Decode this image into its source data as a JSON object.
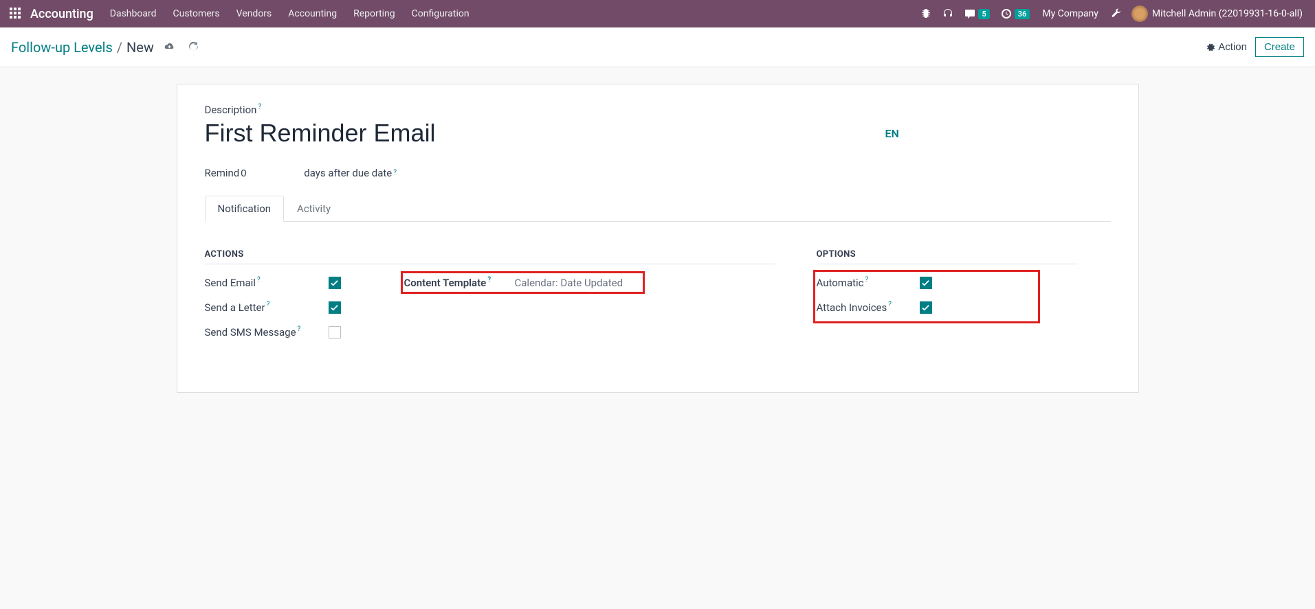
{
  "navbar": {
    "brand": "Accounting",
    "items": [
      "Dashboard",
      "Customers",
      "Vendors",
      "Accounting",
      "Reporting",
      "Configuration"
    ],
    "messages_count": "5",
    "activities_count": "36",
    "company": "My Company",
    "user": "Mitchell Admin (22019931-16-0-all)"
  },
  "breadcrumb": {
    "parent": "Follow-up Levels",
    "current": "New"
  },
  "controls": {
    "action_label": "Action",
    "create_label": "Create"
  },
  "form": {
    "description_label": "Description",
    "title": "First Reminder Email",
    "lang": "EN",
    "remind_prefix": "Remind",
    "remind_value": "0",
    "remind_suffix": "days after due date"
  },
  "tabs": {
    "notification": "Notification",
    "activity": "Activity"
  },
  "sections": {
    "actions": "ACTIONS",
    "options": "OPTIONS"
  },
  "actions": {
    "send_email": {
      "label": "Send Email",
      "checked": true
    },
    "send_letter": {
      "label": "Send a Letter",
      "checked": true
    },
    "send_sms": {
      "label": "Send SMS Message",
      "checked": false
    },
    "content_template_label": "Content Template",
    "content_template_value": "Calendar: Date Updated"
  },
  "options": {
    "automatic": {
      "label": "Automatic",
      "checked": true
    },
    "attach_invoices": {
      "label": "Attach Invoices",
      "checked": true
    }
  }
}
